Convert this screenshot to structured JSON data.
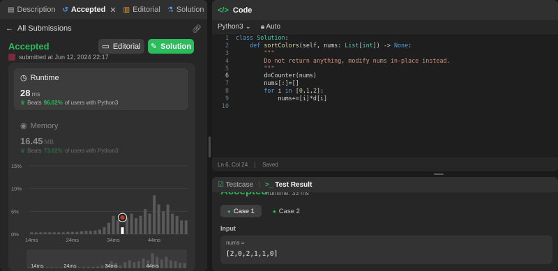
{
  "left_tabs": [
    {
      "label": "Description",
      "icon": "description-icon"
    },
    {
      "label": "Accepted",
      "icon": "history-icon"
    },
    {
      "label": "Editorial",
      "icon": "book-icon"
    },
    {
      "label": "Solution",
      "icon": "flask-icon"
    }
  ],
  "subhead": {
    "back_label": "All Submissions"
  },
  "submission": {
    "status": "Accepted",
    "meta": "submitted at Jun 12, 2024 22:17",
    "editorial_label": "Editorial",
    "solution_label": "Solution"
  },
  "runtime": {
    "label": "Runtime",
    "value": "28",
    "unit": "ms",
    "beats_prefix": "Beats",
    "beats_pct": "96.02%",
    "beats_suffix": "of users with Python3"
  },
  "memory": {
    "label": "Memory",
    "value": "16.45",
    "unit": "MB",
    "beats_prefix": "Beats",
    "beats_pct": "73.02%",
    "beats_suffix": "of users with Python3"
  },
  "chart_data": {
    "type": "bar",
    "ytick_labels": [
      "15%",
      "10%",
      "5%",
      "0%"
    ],
    "xtick_labels": [
      "14ms",
      "24ms",
      "34ms",
      "44ms"
    ],
    "ylim": [
      0,
      15
    ],
    "highlight_index": 20,
    "values": [
      0.4,
      0.4,
      0.4,
      0.4,
      0.4,
      0.4,
      0.4,
      0.4,
      0.5,
      0.5,
      0.5,
      0.6,
      0.7,
      0.7,
      0.8,
      1.0,
      1.5,
      2.5,
      4.0,
      3.0,
      1.5,
      3.5,
      4.5,
      3.5,
      4.0,
      5.5,
      4.5,
      8.5,
      6.5,
      5.0,
      6.5,
      4.5,
      4.0,
      3.0,
      3.0
    ]
  },
  "mini_chart": {
    "xtick_labels": [
      "14ms",
      "24ms",
      "34ms",
      "44ms"
    ]
  },
  "editor": {
    "title": "Code",
    "language": "Python3",
    "mode": "Auto",
    "status_position": "Ln 6, Col 24",
    "status_saved": "Saved",
    "current_line": 6,
    "lines": [
      {
        "n": "1",
        "html": "<span class='kw'>class</span> <span class='ty'>Solution</span>:"
      },
      {
        "n": "2",
        "html": "    <span class='kw'>def</span> <span class='fn'>sortColors</span>(self, nums: <span class='ty'>List</span>[<span class='ty'>int</span>]) -&gt; <span class='kw'>None</span>:"
      },
      {
        "n": "3",
        "html": "        <span class='str'>\"\"\"</span>"
      },
      {
        "n": "4",
        "html": "        <span class='str'>Do not return anything, modify nums in-place instead.</span>"
      },
      {
        "n": "5",
        "html": "        <span class='str'>\"\"\"</span>"
      },
      {
        "n": "6",
        "html": "        d=Counter(nums)"
      },
      {
        "n": "7",
        "html": "        nums[:]=[]"
      },
      {
        "n": "8",
        "html": "        <span class='kw'>for</span> i <span class='kw'>in</span> [<span class='num'>0</span>,<span class='num'>1</span>,<span class='num'>2</span>]:"
      },
      {
        "n": "9",
        "html": "            nums+=[i]*d[i]"
      },
      {
        "n": "10",
        "html": ""
      }
    ]
  },
  "result": {
    "tab_testcase": "Testcase",
    "tab_result": "Test Result",
    "title": "Accepted",
    "runtime": "Runtime: 33 ms",
    "case1": "Case 1",
    "case2": "Case 2",
    "input_label": "Input",
    "input_name": "nums =",
    "input_value": "[2,0,2,1,1,0]"
  },
  "colors": {
    "accent": "#2cbb5d",
    "bar": "#5a5a5a",
    "bar_highlight": "#ffffff"
  }
}
